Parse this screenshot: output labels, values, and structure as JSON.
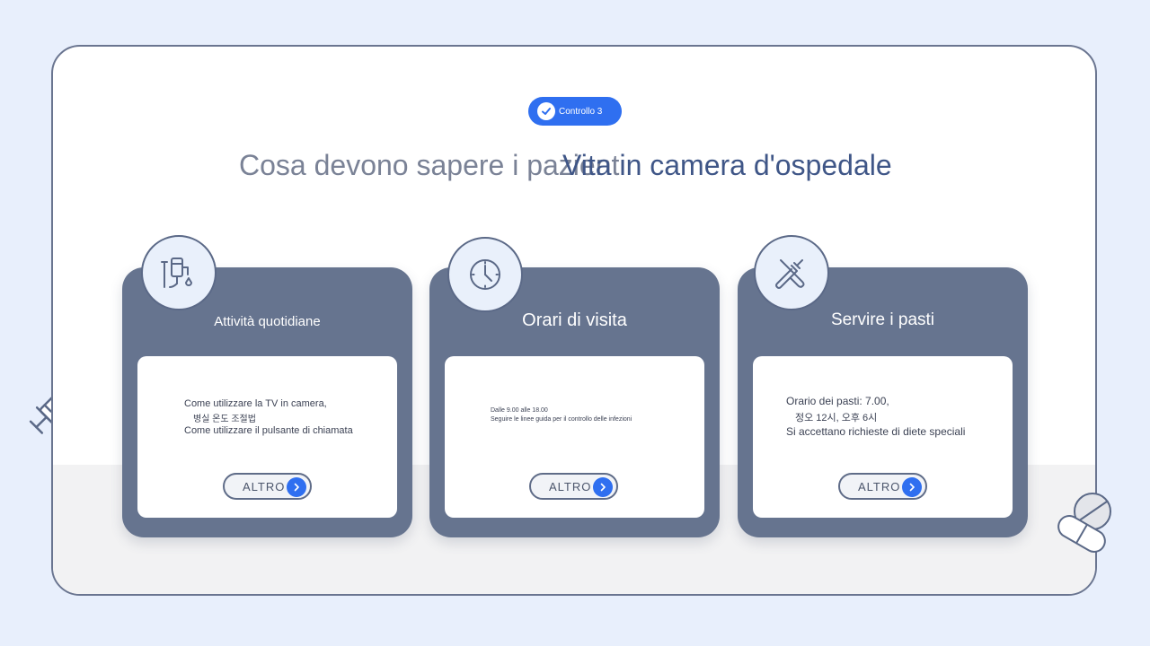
{
  "header": {
    "badge_label": "Controllo 3",
    "title_primary": "Cosa devono sapere i pazienti",
    "title_secondary": "Vita in camera d'ospedale"
  },
  "cards": [
    {
      "title": "Attività quotidiane",
      "icon": "iv-drip-icon",
      "lines": [
        "Come utilizzare la TV in camera,",
        "병실 온도 조절법",
        "Come utilizzare il pulsante di chiamata"
      ],
      "button_label": "ALTRO"
    },
    {
      "title": "Orari di visita",
      "icon": "clock-icon",
      "lines": [
        "Dalle 9.00 alle 18.00",
        "Seguire le linee guida per il controllo delle infezioni"
      ],
      "button_label": "ALTRO"
    },
    {
      "title": "Servire i pasti",
      "icon": "fork-knife-icon",
      "lines": [
        "Orario dei pasti: 7.00,",
        "정오 12시, 오후 6시",
        "Si accettano richieste di diete speciali"
      ],
      "button_label": "ALTRO"
    }
  ],
  "colors": {
    "accent": "#2f6ff0",
    "card": "#66748f",
    "title_secondary": "#3f5687"
  }
}
